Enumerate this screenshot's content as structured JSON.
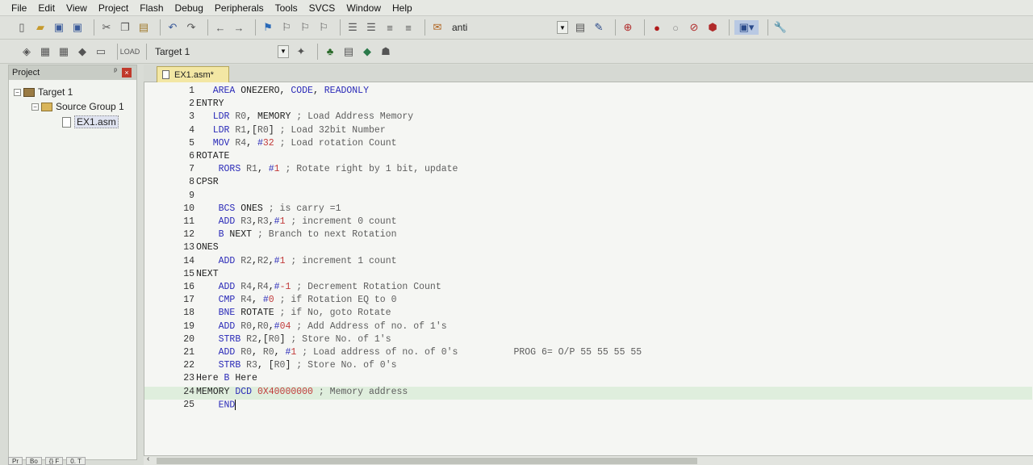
{
  "menu": [
    "File",
    "Edit",
    "View",
    "Project",
    "Flash",
    "Debug",
    "Peripherals",
    "Tools",
    "SVCS",
    "Window",
    "Help"
  ],
  "toolbar1": {
    "find_text": "anti"
  },
  "toolbar2": {
    "target": "Target 1"
  },
  "project": {
    "title": "Project",
    "pin_icon": "pin-icon",
    "close_icon": "close-icon",
    "tree": {
      "root": "Target 1",
      "group": "Source Group 1",
      "file": "EX1.asm"
    }
  },
  "bottom_tabs": [
    "Pr",
    "Bo",
    "{} F",
    "0. T"
  ],
  "editor": {
    "tab": "EX1.asm*",
    "lines": [
      {
        "n": "1",
        "code": "   AREA ONEZERO, CODE, READONLY"
      },
      {
        "n": "2",
        "code": "ENTRY"
      },
      {
        "n": "3",
        "code": "   LDR R0, MEMORY ; Load Address Memory"
      },
      {
        "n": "4",
        "code": "   LDR R1,[R0] ; Load 32bit Number"
      },
      {
        "n": "5",
        "code": "   MOV R4, #32 ; Load rotation Count"
      },
      {
        "n": "6",
        "code": "ROTATE"
      },
      {
        "n": "7",
        "code": "    RORS R1, #1 ; Rotate right by 1 bit, update"
      },
      {
        "n": "8",
        "code": "CPSR"
      },
      {
        "n": "9",
        "code": ""
      },
      {
        "n": "10",
        "code": "    BCS ONES ; is carry =1"
      },
      {
        "n": "11",
        "code": "    ADD R3,R3,#1 ; increment 0 count"
      },
      {
        "n": "12",
        "code": "    B NEXT ; Branch to next Rotation"
      },
      {
        "n": "13",
        "code": "ONES"
      },
      {
        "n": "14",
        "code": "    ADD R2,R2,#1 ; increment 1 count"
      },
      {
        "n": "15",
        "code": "NEXT"
      },
      {
        "n": "16",
        "code": "    ADD R4,R4,#-1 ; Decrement Rotation Count"
      },
      {
        "n": "17",
        "code": "    CMP R4, #0 ; if Rotation EQ to 0"
      },
      {
        "n": "18",
        "code": "    BNE ROTATE ; if No, goto Rotate"
      },
      {
        "n": "19",
        "code": "    ADD R0,R0,#04 ; Add Address of no. of 1's"
      },
      {
        "n": "20",
        "code": "    STRB R2,[R0] ; Store No. of 1's"
      },
      {
        "n": "21",
        "code": "    ADD R0, R0, #1 ; Load address of no. of 0's          PROG 6= O/P 55 55 55 55"
      },
      {
        "n": "22",
        "code": "    STRB R3, [R0] ; Store No. of 0's"
      },
      {
        "n": "23",
        "code": "Here B Here"
      },
      {
        "n": "24",
        "code": "MEMORY DCD 0X40000000 ; Memory address"
      },
      {
        "n": "25",
        "code": "    END"
      }
    ]
  },
  "colors": {
    "keyword": "#2a2ab8",
    "number": "#c23b3b",
    "comment": "#5d5d5d",
    "active_tab": "#f3e7a4",
    "current_line": "#dfeedd"
  }
}
